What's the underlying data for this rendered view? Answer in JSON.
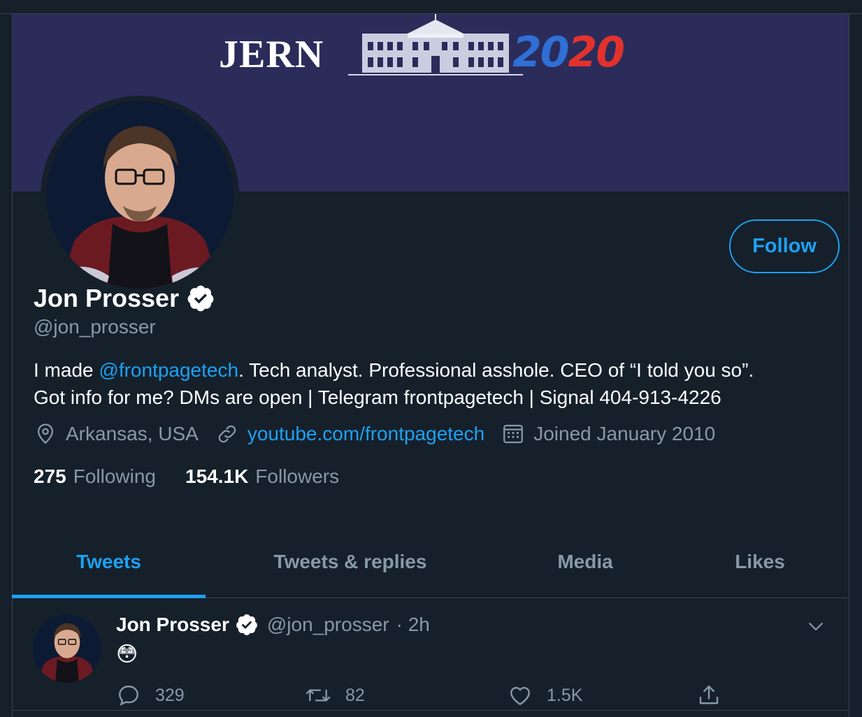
{
  "banner": {
    "word": "JERN",
    "year_part1": "20",
    "year_part2": "20",
    "colors": {
      "background": "#2b2c5a",
      "blue": "#2f6fd6",
      "red": "#e2322e"
    }
  },
  "profile": {
    "name": "Jon Prosser",
    "handle": "@jon_prosser",
    "follow_label": "Follow",
    "bio_line1_prefix": "I made ",
    "bio_mention": "@frontpagetech",
    "bio_line1_suffix": ". Tech analyst. Professional asshole. CEO of “I told you so”.",
    "bio_line2": "Got info for me? DMs are open | Telegram frontpagetech | Signal 404-913-4226",
    "location": "Arkansas, USA",
    "website": "youtube.com/frontpagetech",
    "joined": "Joined January 2010",
    "following_count": "275",
    "following_label": "Following",
    "followers_count": "154.1K",
    "followers_label": "Followers"
  },
  "tabs": [
    {
      "label": "Tweets",
      "active": true
    },
    {
      "label": "Tweets & replies",
      "active": false
    },
    {
      "label": "Media",
      "active": false
    },
    {
      "label": "Likes",
      "active": false
    }
  ],
  "tweet": {
    "name": "Jon Prosser",
    "handle": "@jon_prosser",
    "time": "· 2h",
    "body": "😳",
    "replies": "329",
    "retweets": "82",
    "likes": "1.5K"
  },
  "colors": {
    "accent": "#1da1f2",
    "background": "#15202b",
    "muted": "#8899a6",
    "border": "#38444d"
  }
}
